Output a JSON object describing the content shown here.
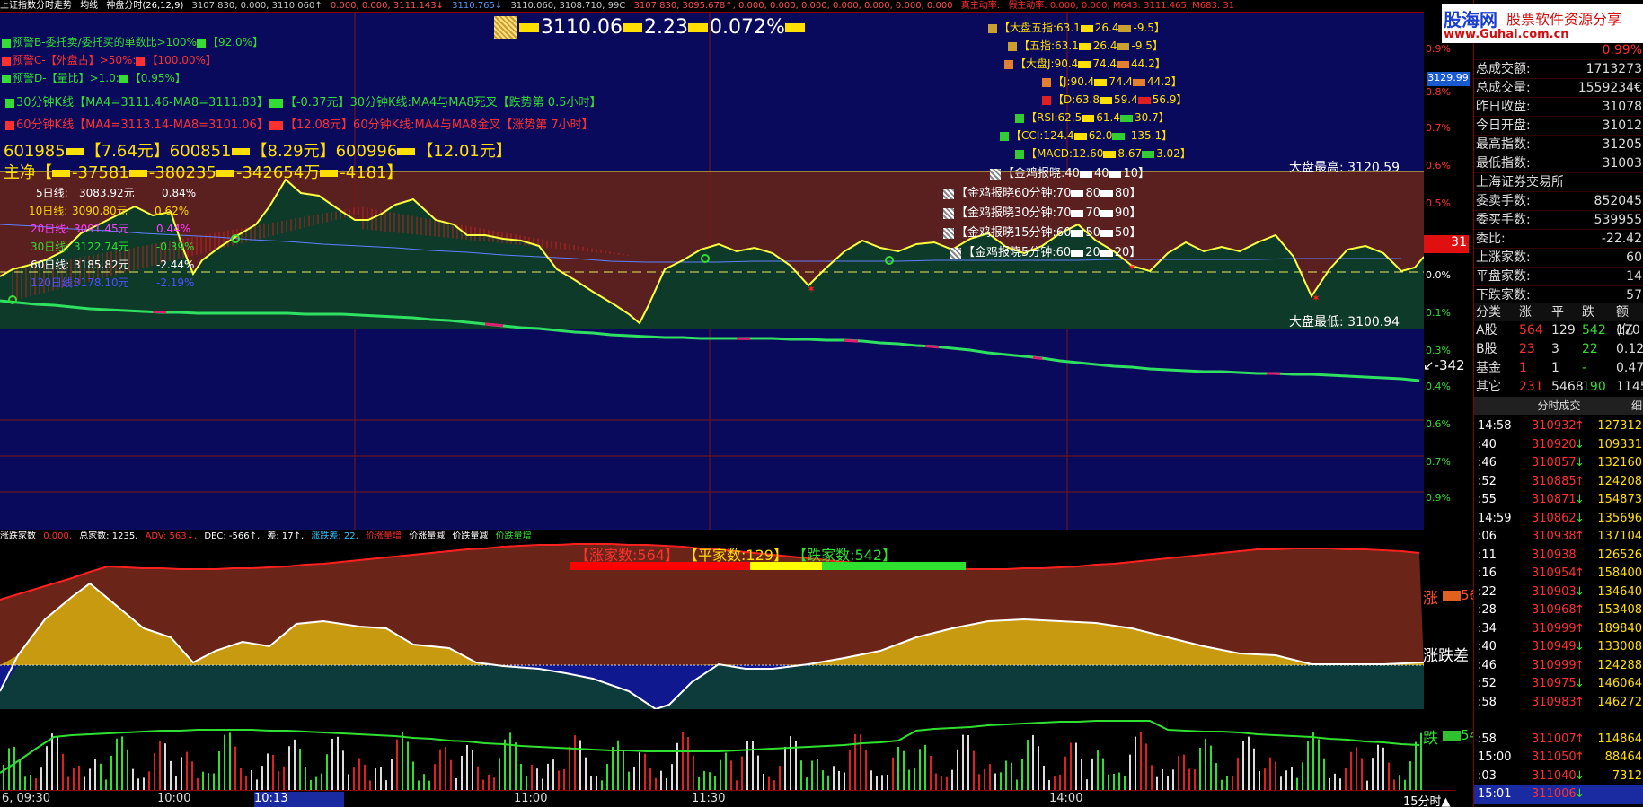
{
  "topbar": {
    "title": "上证指数分时走势",
    "junxian": "均线",
    "shenpan": "神盘分时(26,12,9)",
    "items": [
      "3107.830, 0.000, 3110.060↑",
      "0.000, 0.000, 3111.143↓",
      "3110.765↓",
      "3110.060, 3108.710, 99C",
      "3107.830, 3095.678↑, 0.000, 0.000, 0.000, 0.000, 0.000, 0.000, 0.000",
      "真主动率:",
      "假主动率: 0.000, 0.000, M643: 3111.465, M683: 31"
    ]
  },
  "header": {
    "price": "3110.06",
    "change": "2.23",
    "pct": "0.072%"
  },
  "warnings": [
    {
      "text": "预警B-委托卖/委托买的单数比>100%",
      "val": "【92.0%】",
      "color": "#33dd33"
    },
    {
      "text": "预警C-【外盘占】>50%:",
      "val": "【100.00%】",
      "color": "#ff3030"
    },
    {
      "text": "预警D-【量比】>1.0:",
      "val": "【0.95%】",
      "color": "#33dd33"
    }
  ],
  "kline30": {
    "a": "30分钟K线【MA4=3111.46-MA8=3111.83】",
    "b": "【-0.37元】30分钟K线:MA4与MA8死叉【跌势第 0.5小时】"
  },
  "kline60": {
    "a": "60分钟K线【MA4=3113.14-MA8=3101.06】",
    "b": "【12.08元】60分钟K线:MA4与MA8金叉【涨势第 7小时】"
  },
  "stocks": [
    {
      "code": "601985",
      "price": "【7.64元】"
    },
    {
      "code": "600851",
      "price": "【8.29元】"
    },
    {
      "code": "600996",
      "price": "【12.01元】"
    }
  ],
  "zhujing": {
    "label": "主净【",
    "v1": "-37581",
    "v2": "-380235",
    "v3": "-342654万",
    "v4": "-4181】"
  },
  "ma": [
    {
      "label": "5日线:",
      "val": "3083.92元",
      "pct": "0.84%",
      "color": "#ffffff"
    },
    {
      "label": "10日线:",
      "val": "3090.80元",
      "pct": "0.62%",
      "color": "#ffd700"
    },
    {
      "label": "20日线:",
      "val": "3091.45元",
      "pct": "0.44%",
      "color": "#ff40ff"
    },
    {
      "label": "30日线:",
      "val": "3122.74元",
      "pct": "-0.39%",
      "color": "#33dd33"
    },
    {
      "label": "60日线:",
      "val": "3185.82元",
      "pct": "-2.44%",
      "color": "#ffffff"
    },
    {
      "label": "120日线:",
      "val": "3178.10元",
      "pct": "-2.19%",
      "color": "#5050ff"
    }
  ],
  "indicators": [
    {
      "text": "【大盘五指:63.1",
      "b": "26.4",
      "c": "-9.5】"
    },
    {
      "text": "【五指:63.1",
      "b": "26.4",
      "c": "-9.5】"
    },
    {
      "text": "【大盘J:90.4",
      "b": "74.4",
      "c": "44.2】"
    },
    {
      "text": "【J:90.4",
      "b": "74.4",
      "c": "44.2】"
    },
    {
      "text": "【D:63.8",
      "b": "59.4",
      "c": "56.9】"
    },
    {
      "text": "【RSI:62.5",
      "b": "61.4",
      "c": "30.7】"
    },
    {
      "text": "【CCI:124.4",
      "b": "62.0",
      "c": "-135.1】"
    },
    {
      "text": "【MACD:12.60",
      "b": "8.67",
      "c": "3.02】"
    }
  ],
  "gold": [
    {
      "text": "【金鸡报晓:40",
      "b": "40",
      "c": "10】"
    },
    {
      "text": "【金鸡报晓60分钟:70",
      "b": "80",
      "c": "80】"
    },
    {
      "text": "【金鸡报晓30分钟:70",
      "b": "70",
      "c": "90】"
    },
    {
      "text": "【金鸡报晓15分钟:60",
      "b": "50",
      "c": "50】"
    },
    {
      "text": "【金鸡报晓5分钟:60",
      "b": "20",
      "c": "20】"
    }
  ],
  "high_label": "大盘最高: 3120.59",
  "low_label": "大盘最低: 3100.94",
  "right_axis": [
    {
      "t": "0.9%",
      "c": "#ff3030"
    },
    {
      "t": "0.8%",
      "c": "#ff3030"
    },
    {
      "t": "0.7%",
      "c": "#ff3030"
    },
    {
      "t": "0.6%",
      "c": "#ff3030"
    },
    {
      "t": "0.5%",
      "c": "#ff3030"
    },
    {
      "t": "0.4%",
      "c": "#ff3030"
    },
    {
      "t": "0.3%",
      "c": "#ff3030"
    },
    {
      "t": "0.2%",
      "c": "#ff3030"
    },
    {
      "t": "0.1%",
      "c": "#ff3030"
    },
    {
      "t": "0.0%",
      "c": "#ffffff"
    },
    {
      "t": "0.1%",
      "c": "#33dd33"
    },
    {
      "t": "0.3%",
      "c": "#33dd33"
    },
    {
      "t": "0.4%",
      "c": "#33dd33"
    },
    {
      "t": "0.6%",
      "c": "#33dd33"
    },
    {
      "t": "0.7%",
      "c": "#33dd33"
    },
    {
      "t": "0.9%",
      "c": "#33dd33"
    }
  ],
  "axis_price": "3129.99",
  "axis_mark": "31",
  "axis_arrow": "↙-342",
  "lower_bar": {
    "title": "涨跌家数",
    "v0": "0.000,",
    "zong": "总家数: 1235,",
    "adv": "ADV: 563↓,",
    "dec": "DEC: -566↑,",
    "cha": "差: 17↑,",
    "zdc": "涨跌差: 22,",
    "p1": "价涨量增",
    "p2": "价涨量减",
    "p3": "价跌量减",
    "p4": "价跌量增"
  },
  "counts": {
    "up": "【涨家数:564】",
    "flat": "【平家数:129】",
    "down": "【跌家数:542】"
  },
  "lower_right": {
    "zhang": "涨",
    "zval": "56",
    "zdc": "涨跌差",
    "die": "跌",
    "dval": "54"
  },
  "time_axis": [
    "6, 09:30",
    "10:00",
    "10:13",
    "11:00",
    "11:30",
    "14:00",
    "15分时▲"
  ],
  "logo": {
    "name": "股海网",
    "slogan": "股票软件资源分享",
    "url": "www.Guhai.com.cn"
  },
  "panel": {
    "rows": [
      {
        "k": "",
        "v": "0.99%"
      },
      {
        "k": "总成交额:",
        "v": "1713273"
      },
      {
        "k": "总成交量:",
        "v": "1559234€"
      },
      {
        "k": "昨日收盘:",
        "v": "31078"
      },
      {
        "k": "今日开盘:",
        "v": "31012"
      },
      {
        "k": "最高指数:",
        "v": "31205"
      },
      {
        "k": "最低指数:",
        "v": "31003"
      },
      {
        "k": "上海证券交易所",
        "v": ""
      },
      {
        "k": "委卖手数:",
        "v": "852045"
      },
      {
        "k": "委买手数:",
        "v": "539955"
      },
      {
        "k": "委比:",
        "v": "-22.42"
      },
      {
        "k": "上涨家数:",
        "v": "60"
      },
      {
        "k": "平盘家数:",
        "v": "14"
      },
      {
        "k": "下跌家数:",
        "v": "57"
      }
    ],
    "table_head": [
      "分类",
      "涨",
      "平",
      "跌",
      "额(亿"
    ],
    "table": [
      [
        "A股",
        "564",
        "129",
        "542",
        "170"
      ],
      [
        "B股",
        "23",
        "3",
        "22",
        "0.12"
      ],
      [
        "基金",
        "1",
        "1",
        "-",
        "0.47"
      ],
      [
        "其它",
        "231",
        "5468",
        "190",
        "1145"
      ]
    ],
    "ticks_head": "分时成交",
    "ticks_head2": "细",
    "ticks": [
      [
        "14:58",
        "310932",
        "↑",
        "127312"
      ],
      [
        ":40",
        "310920",
        "↓",
        "109331"
      ],
      [
        ":46",
        "310857",
        "↓",
        "132160"
      ],
      [
        ":52",
        "310885",
        "↑",
        "124208"
      ],
      [
        ":55",
        "310871",
        "↓",
        "154873"
      ],
      [
        "14:59",
        "310862",
        "↓",
        "135696"
      ],
      [
        ":06",
        "310938",
        "↑",
        "137104"
      ],
      [
        ":11",
        "310938",
        "",
        "126526"
      ],
      [
        ":16",
        "310954",
        "↑",
        "158400"
      ],
      [
        ":22",
        "310903",
        "↓",
        "134640"
      ],
      [
        ":28",
        "310968",
        "↑",
        "153408"
      ],
      [
        ":34",
        "310999",
        "↑",
        "189840"
      ],
      [
        ":40",
        "310949",
        "↓",
        "133008"
      ],
      [
        ":46",
        "310999",
        "↑",
        "124288"
      ],
      [
        ":52",
        "310975",
        "↓",
        "146064"
      ],
      [
        ":58",
        "310983",
        "↑",
        "146272"
      ],
      [
        "",
        "",
        " ",
        ""
      ],
      [
        ":58",
        "311007",
        "↑",
        "114864"
      ],
      [
        "15:00",
        "311050",
        "↑",
        "88464"
      ],
      [
        ":03",
        "311040",
        "↓",
        "7312"
      ],
      [
        "15:01",
        "311006",
        "↓",
        ""
      ]
    ]
  }
}
